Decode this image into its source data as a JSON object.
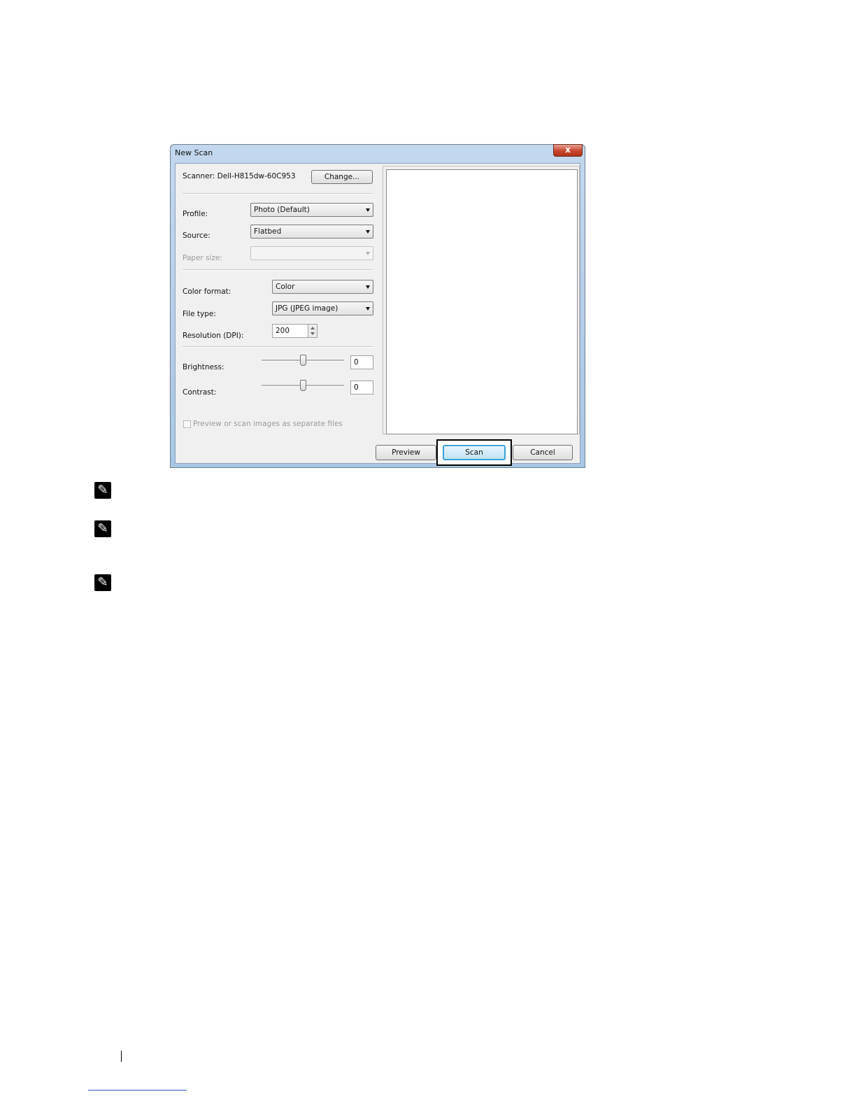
{
  "window": {
    "title": "New Scan",
    "close_label": "x"
  },
  "scanner": {
    "label": "Scanner: Dell-H815dw-60C953",
    "change_label": "Change..."
  },
  "fields": {
    "profile": {
      "label": "Profile:",
      "value": "Photo (Default)"
    },
    "source": {
      "label": "Source:",
      "value": "Flatbed"
    },
    "paper_size": {
      "label": "Paper size:",
      "value": ""
    },
    "color_format": {
      "label": "Color format:",
      "value": "Color"
    },
    "file_type": {
      "label": "File type:",
      "value": "JPG (JPEG image)"
    },
    "resolution": {
      "label": "Resolution (DPI):",
      "value": "200"
    },
    "brightness": {
      "label": "Brightness:",
      "value": "0"
    },
    "contrast": {
      "label": "Contrast:",
      "value": "0"
    }
  },
  "sliders": {
    "brightness_level": 0.5,
    "contrast_level": 0.5
  },
  "separate_files": {
    "label": "Preview or scan images as separate files",
    "checked": false,
    "enabled": false
  },
  "buttons": {
    "preview": "Preview",
    "scan": "Scan",
    "cancel": "Cancel"
  },
  "notes": {
    "icon": "pencil-note-icon",
    "count": 3
  },
  "colors": {
    "scan_button_border": "#3c9fd8",
    "title_bar": "#a9c6e6",
    "close_button": "#c8452f"
  }
}
